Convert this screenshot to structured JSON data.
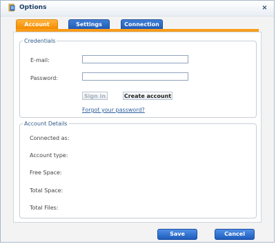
{
  "window": {
    "title": "Options",
    "close_glyph": "×"
  },
  "tabs": [
    {
      "label": "Account",
      "active": true
    },
    {
      "label": "Settings",
      "active": false
    },
    {
      "label": "Connection",
      "active": false
    }
  ],
  "credentials": {
    "legend": "Credentials",
    "email_label": "E-mail:",
    "email_value": "",
    "password_label": "Password:",
    "password_value": "",
    "sign_in_label": "Sign in",
    "create_account_label": "Create account",
    "forgot_link": "Forgot  your password?"
  },
  "account_details": {
    "legend": "Account Details",
    "rows": [
      {
        "label": "Connected  as:"
      },
      {
        "label": "Account type:"
      },
      {
        "label": "Free Space:"
      },
      {
        "label": "Total Space:"
      },
      {
        "label": "Total Files:"
      }
    ]
  },
  "footer": {
    "save_label": "Save",
    "cancel_label": "Cancel"
  },
  "colors": {
    "active_tab": "#f48b00",
    "inactive_tab": "#1f5bb4",
    "link": "#2a5d9e",
    "legend": "#2f5a8a"
  },
  "icons": {
    "app": "options-app-icon",
    "close": "close-icon"
  }
}
